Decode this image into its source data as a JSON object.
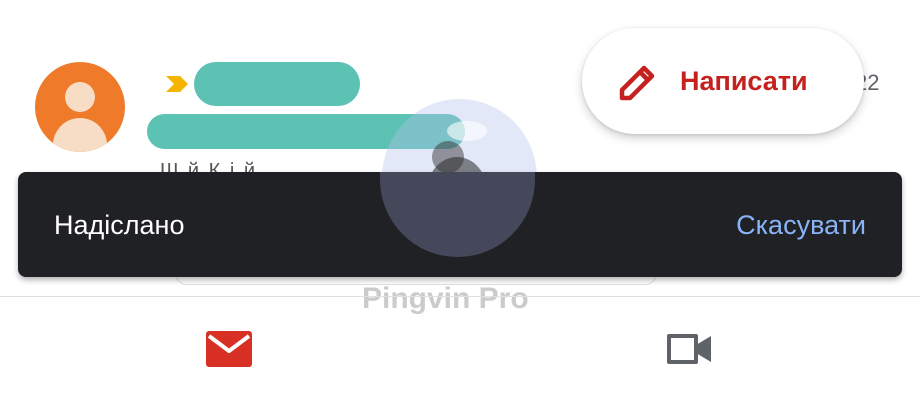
{
  "email_row": {
    "snippet": "Ш                  й  К і                                                    й",
    "time_fragment": "22"
  },
  "compose": {
    "label": "Написати",
    "icon": "pencil-icon",
    "color": "#c5221f"
  },
  "snackbar": {
    "message": "Надіслано",
    "action": "Скасувати",
    "action_color": "#8ab4f8"
  },
  "watermark": {
    "text": "Pingvin Pro"
  },
  "bottom_nav": {
    "items": [
      {
        "icon": "mail-icon",
        "color": "#d93025"
      },
      {
        "icon": "video-camera-icon",
        "color": "#5f6368"
      }
    ]
  }
}
